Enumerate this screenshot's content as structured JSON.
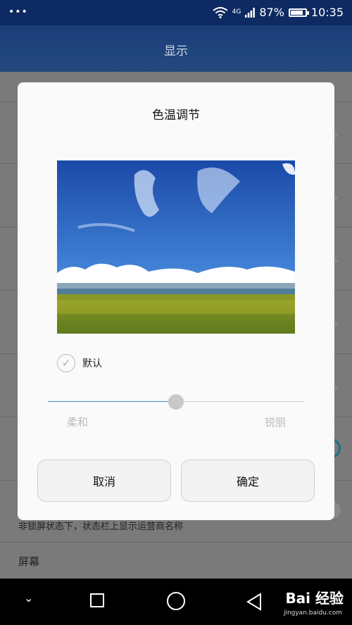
{
  "status_bar": {
    "dots": "•••",
    "network": "4G",
    "battery": "87%",
    "battery_level": 0.87,
    "time": "10:35"
  },
  "app_bar": {
    "title": "显示"
  },
  "background": {
    "row_text_1": "非锁屏状态下，状态栏上显示运营商名称",
    "row_text_2": "屏幕"
  },
  "dialog": {
    "title": "色温调节",
    "default_checkbox_label": "默认",
    "default_checked": true,
    "slider": {
      "min_label": "柔和",
      "max_label": "锐丽",
      "value": 0.5
    },
    "cancel_label": "取消",
    "ok_label": "确定"
  },
  "nav_bar": {
    "watermark": "Bai 经验",
    "watermark_sub": "jingyan.baidu.com"
  }
}
